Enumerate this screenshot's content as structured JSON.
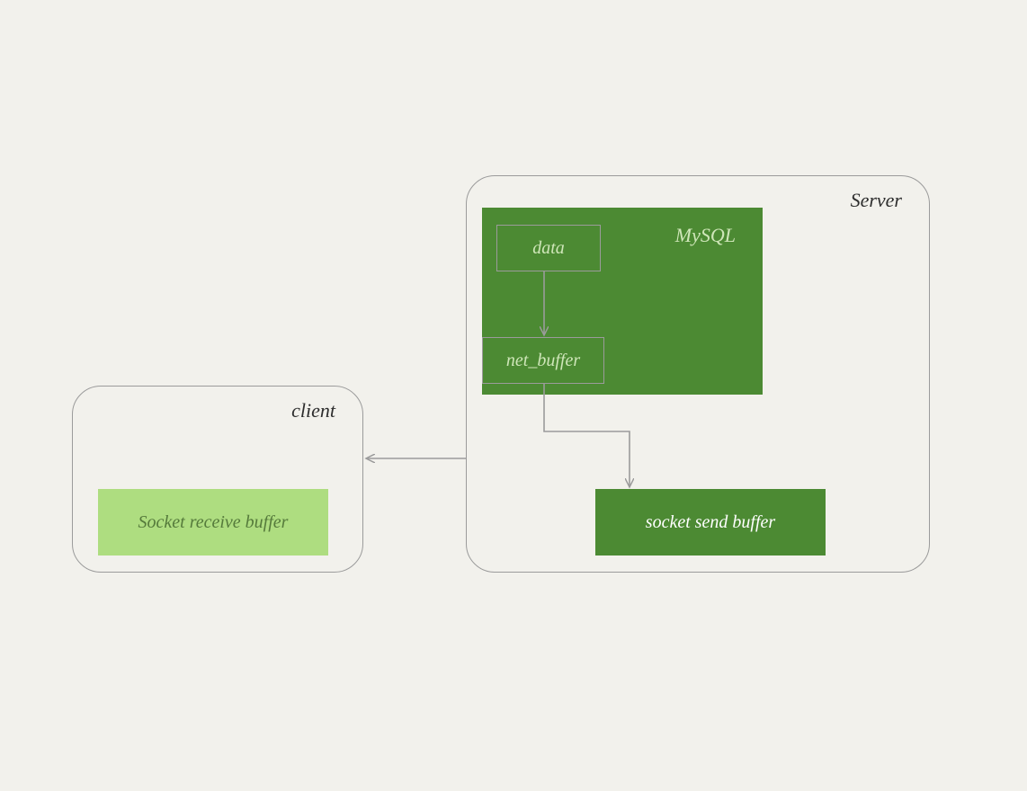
{
  "diagram": {
    "server": {
      "label": "Server"
    },
    "client": {
      "label": "client"
    },
    "mysql": {
      "label": "MySQL"
    },
    "boxes": {
      "data": {
        "label": "data"
      },
      "net_buffer": {
        "label": "net_buffer"
      },
      "socket_send": {
        "label": "socket send buffer"
      },
      "socket_receive": {
        "label": "Socket receive buffer"
      }
    },
    "colors": {
      "bg": "#f2f1ec",
      "border": "#9b9b9b",
      "greenDark": "#4c8a33",
      "greenLight": "#aedd80",
      "textOnDark": "#cfe6b9"
    }
  }
}
